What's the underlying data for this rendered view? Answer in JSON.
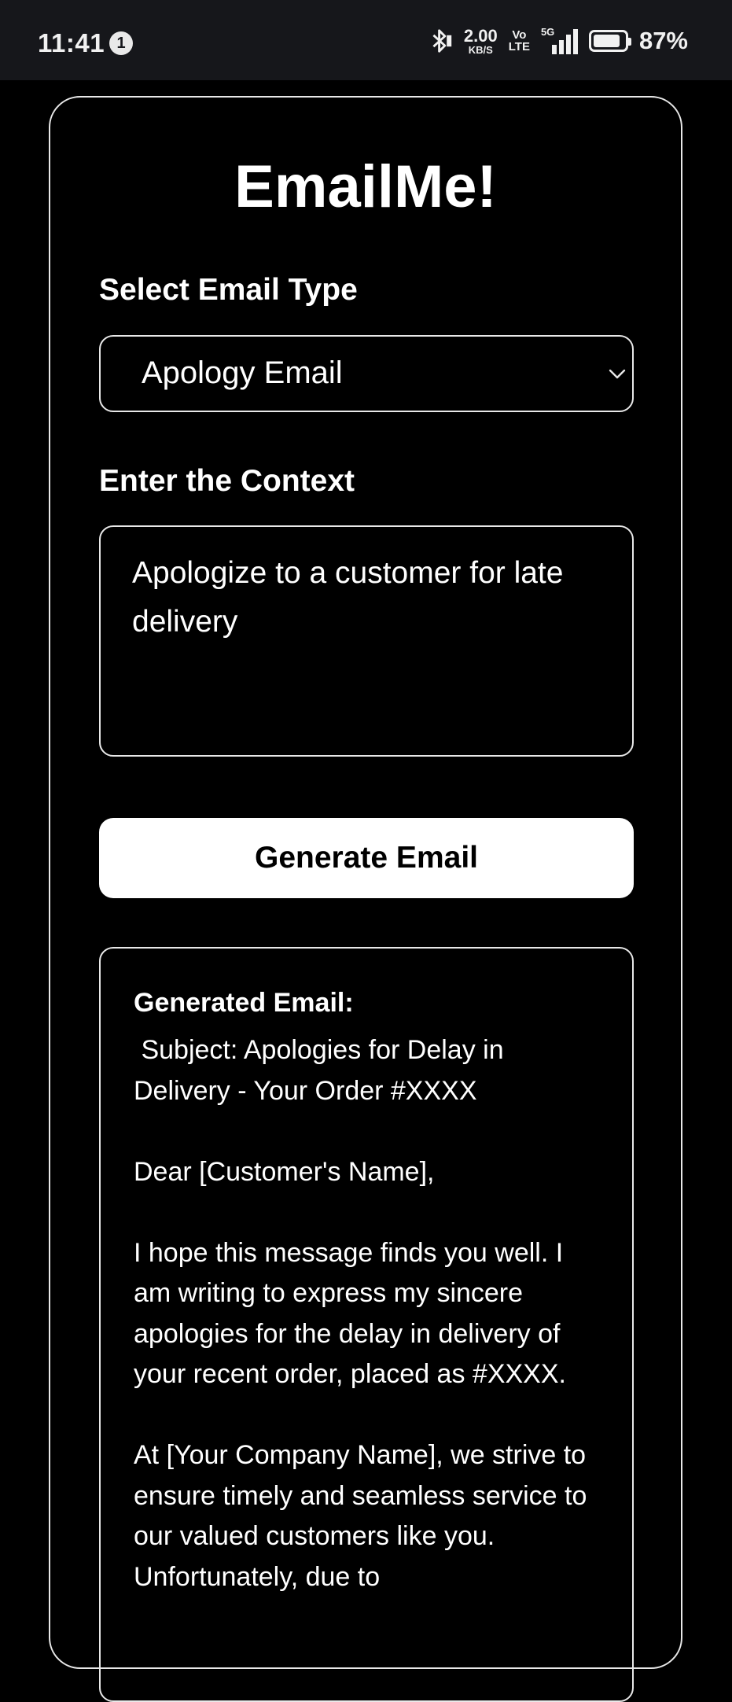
{
  "status_bar": {
    "time": "11:41",
    "notification_count": "1",
    "net_speed_value": "2.00",
    "net_speed_unit": "KB/S",
    "volte_top": "Vo",
    "volte_bottom": "LTE",
    "network_type": "5G",
    "battery_percent": "87%",
    "battery_level": 0.87
  },
  "app": {
    "title": "EmailMe!"
  },
  "form": {
    "email_type_label": "Select Email Type",
    "email_type_value": "Apology Email",
    "context_label": "Enter the Context",
    "context_value": "Apologize to a customer for late delivery",
    "generate_button": "Generate Email"
  },
  "result": {
    "heading": "Generated Email:",
    "paragraphs": [
      " Subject: Apologies for Delay in Delivery - Your Order #XXXX",
      "Dear [Customer's Name],",
      "I hope this message finds you well. I am writing to express my sincere apologies for the delay in delivery of your recent order, placed as #XXXX.",
      "At [Your Company Name], we strive to ensure timely and seamless service to our valued customers like you. Unfortunately, due to"
    ]
  },
  "colors": {
    "background": "#000000",
    "status_bar": "#16171b",
    "border": "#e8e8e8",
    "button_bg": "#ffffff",
    "button_text": "#000000"
  }
}
